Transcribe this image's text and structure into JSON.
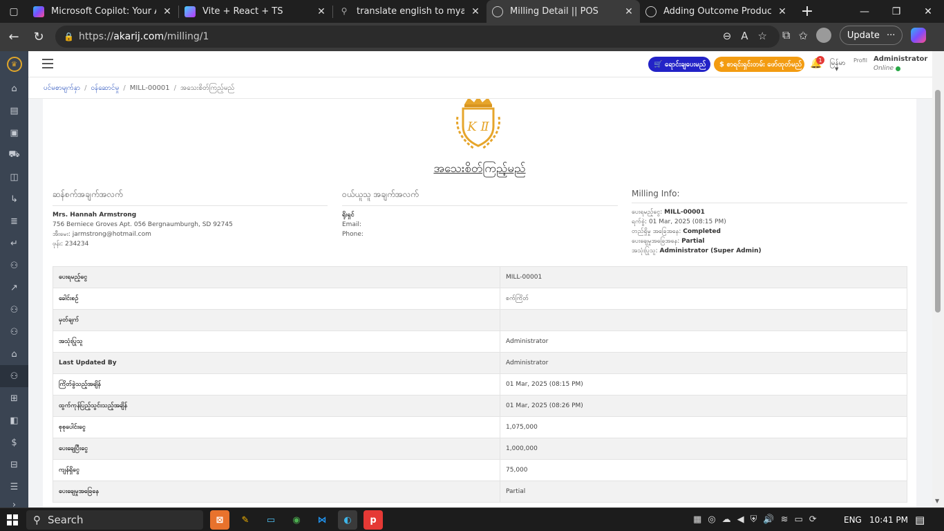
{
  "browser": {
    "tabs": [
      {
        "title": "Microsoft Copilot: Your AI com",
        "fav": "#8a5cf6",
        "active": false
      },
      {
        "title": "Vite + React + TS",
        "fav": "#8b5cf6",
        "active": false
      },
      {
        "title": "translate english to myanmar -",
        "fav": "#3b3b3b",
        "active": false
      },
      {
        "title": "Milling Detail || POS",
        "fav": "#5a5a5a",
        "active": true
      },
      {
        "title": "Adding Outcome Products || P",
        "fav": "#5a5a5a",
        "active": false
      }
    ],
    "close_glyph": "✕",
    "new_tab_glyph": "+",
    "url_prefix": "https://",
    "url_host": "akarij.com",
    "url_path": "/milling/1",
    "update_label": "Update"
  },
  "app": {
    "header": {
      "pill_blue": "🛒 ရောင်းချပေးမည်",
      "pill_orange": "$ စာရင်းရှင်းတမ်း ဖော်ထုတ်မည်",
      "notif_count": "1",
      "language": "မြန်မာ",
      "avatar_alt": "Profil",
      "user_name": "Administrator",
      "user_status": "Online"
    },
    "breadcrumb": {
      "home": "ပင်မစာမျက်နှာ",
      "section": "ဝန်ဆောင်မှု",
      "id": "MILL-00001",
      "current": "အသေးစိတ်ကြည့်မည်"
    },
    "document": {
      "title": "အသေးစိတ်ကြည့်မည်",
      "customer": {
        "heading": "ဆန်စက်အချက်အလက်",
        "name": "Mrs. Hannah Armstrong",
        "address": "756 Berniece Groves Apt. 056 Bergnaumburgh, SD 92745",
        "email_label": "အီးမေး",
        "email": "jarmstrong@hotmail.com",
        "phone_label": "ဖုန်း",
        "phone": "234234"
      },
      "supplier": {
        "heading": "ဝယ်ယူသူ အချက်အလက်",
        "name": "ရိုးရှင်",
        "email_label": "Email:",
        "phone_label": "Phone:"
      },
      "milling_info": {
        "heading": "Milling Info:",
        "ref_label": "ပေးရမည့်ငွေ",
        "ref": "MILL-00001",
        "date_label": "ရက်စွဲ",
        "date": "01 Mar, 2025 (08:15 PM)",
        "status_label": "တည်ရှိမှု အခြေအနေ",
        "status": "Completed",
        "payment_label": "ပေးချေမှုအခြေအနေ",
        "payment": "Partial",
        "user_label": "အသုံးပြုသူ",
        "user": "Administrator (Super Admin)"
      },
      "rows": [
        {
          "k": "ပေးရမည့်ငွေ",
          "v": "MILL-00001"
        },
        {
          "k": "ခေါင်းစဉ်",
          "v": "စက်ကြိတ်"
        },
        {
          "k": "မှတ်ချက်",
          "v": ""
        },
        {
          "k": "အသုံးပြုသူ",
          "v": "Administrator"
        },
        {
          "k": "Last Updated By",
          "v": "Administrator"
        },
        {
          "k": "ကြိတ်ခွဲသည့်အချိန်",
          "v": "01 Mar, 2025 (08:15 PM)"
        },
        {
          "k": "ထွက်ကုန်ပြည့်သွင်းသည့်အချိန်",
          "v": "01 Mar, 2025 (08:26 PM)"
        },
        {
          "k": "စုစုပေါင်းငွေ",
          "v": "1,075,000"
        },
        {
          "k": "ပေးချေပြီးငွေ",
          "v": "1,000,000"
        },
        {
          "k": "ကျန်ရှိငွေ",
          "v": "75,000"
        },
        {
          "k": "ပေးချေမှုအခြေနေ",
          "v": "Partial"
        }
      ]
    }
  },
  "taskbar": {
    "search_label": "Search",
    "language": "ENG",
    "time": "10:41 PM"
  }
}
